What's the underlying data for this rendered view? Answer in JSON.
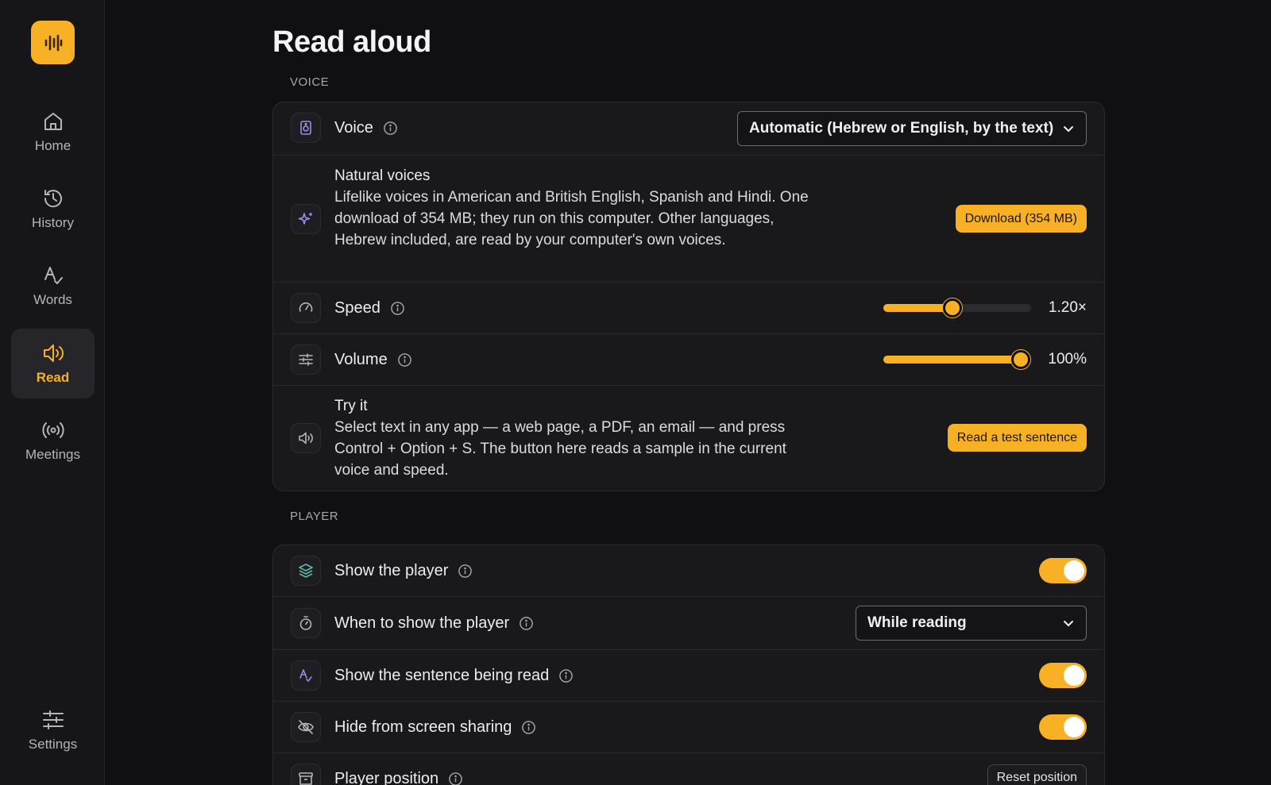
{
  "colors": {
    "accent": "#f8b125",
    "background": "#101012",
    "card": "#19191c"
  },
  "app": {
    "logo_icon": "waveform-icon"
  },
  "sidebar": {
    "items": [
      {
        "label": "Home",
        "icon": "home-icon"
      },
      {
        "label": "History",
        "icon": "history-icon"
      },
      {
        "label": "Words",
        "icon": "spell-check-icon"
      },
      {
        "label": "Read",
        "icon": "speaker-icon",
        "active": true
      },
      {
        "label": "Meetings",
        "icon": "broadcast-icon"
      }
    ],
    "settings": {
      "label": "Settings",
      "icon": "sliders-icon"
    }
  },
  "page": {
    "title": "Read aloud"
  },
  "voice_section": {
    "label": "VOICE",
    "voice": {
      "title": "Voice",
      "selected": "Automatic (Hebrew or English, by the text)"
    },
    "natural": {
      "title": "Natural voices",
      "description": "Lifelike voices in American and British English, Spanish and Hindi. One download of 354 MB; they run on this computer. Other languages, Hebrew included, are read by your computer's own voices.",
      "button": "Download (354 MB)"
    },
    "speed": {
      "title": "Speed",
      "value": "1.20×",
      "fraction": 0.47
    },
    "volume": {
      "title": "Volume",
      "value": "100%",
      "fraction": 0.93
    },
    "try_it": {
      "title": "Try it",
      "description": "Select text in any app — a web page, a PDF, an email — and press Control + Option + S. The button here reads a sample in the current voice and speed.",
      "button": "Read a test sentence"
    }
  },
  "player_section": {
    "label": "PLAYER",
    "show_player": {
      "title": "Show the player",
      "on": true
    },
    "when_to_show": {
      "title": "When to show the player",
      "selected": "While reading"
    },
    "show_sentence": {
      "title": "Show the sentence being read",
      "on": true
    },
    "hide_sharing": {
      "title": "Hide from screen sharing",
      "on": true
    },
    "position": {
      "title": "Player position",
      "button": "Reset position"
    }
  }
}
